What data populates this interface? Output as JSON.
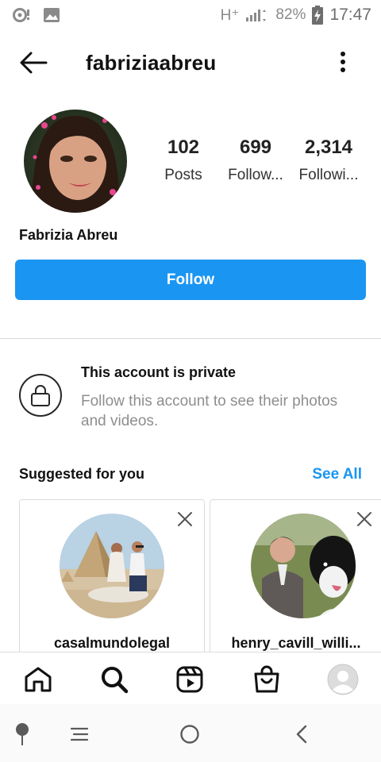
{
  "status_bar": {
    "network": "H⁺",
    "battery_percent": "82%",
    "time": "17:47"
  },
  "header": {
    "username": "fabriziaabreu"
  },
  "profile": {
    "full_name": "Fabrizia Abreu",
    "stats": [
      {
        "value": "102",
        "label": "Posts"
      },
      {
        "value": "699",
        "label": "Follow..."
      },
      {
        "value": "2,314",
        "label": "Followi..."
      }
    ],
    "follow_label": "Follow"
  },
  "private_notice": {
    "title": "This account is private",
    "subtitle": "Follow this account to see their photos and videos."
  },
  "suggested": {
    "title": "Suggested for you",
    "see_all": "See All",
    "cards": [
      {
        "handle": "casalmundolegal"
      },
      {
        "handle": "henry_cavill_willi..."
      }
    ]
  },
  "bottom_nav": {
    "items": [
      "home-icon",
      "search-icon",
      "reels-icon",
      "shop-icon",
      "profile-avatar"
    ]
  },
  "colors": {
    "accent": "#1a95f2",
    "text": "#262626",
    "muted": "#8e8e8e",
    "divider": "#dbdbdb"
  }
}
